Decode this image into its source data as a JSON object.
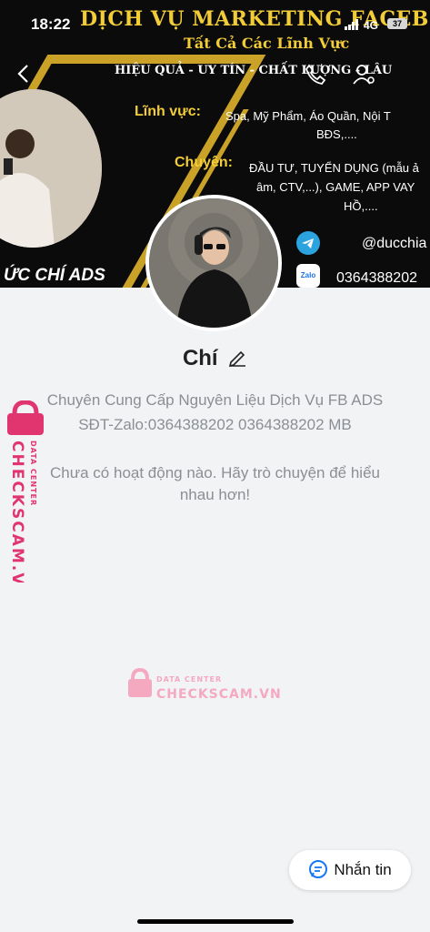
{
  "status": {
    "time": "18:22",
    "network": "4G",
    "battery": "37"
  },
  "cover": {
    "title": "DỊCH VỤ MARKETING FACEBOO",
    "subtitle": "Tất Cả Các Lĩnh Vực",
    "tagline": "HIỆU QUẢ - UY TÍN - CHẤT LƯỢNG - LÂU",
    "field_label": "Lĩnh vực:",
    "field_value": "Spa, Mỹ Phẩm, Áo Quần, Nội T",
    "field_value2": "BĐS,....",
    "spec_label": "Chuyên:",
    "spec_line1": "ĐẦU TƯ, TUYỂN DỤNG (mẫu ả",
    "spec_line2": "âm, CTV,...), GAME, APP VAY",
    "spec_line3": "HỒ,....",
    "telegram": "@ducchia",
    "zalo_label": "Zalo",
    "zalo": "0364388202",
    "brand": "ỨC CHÍ ADS"
  },
  "profile": {
    "name": "Chí",
    "bio_line1": "Chuyên Cung Cấp Nguyên Liệu Dịch Vụ FB ADS",
    "bio_line2": "SĐT-Zalo:0364388202  0364388202 MB",
    "empty_line1": "Chưa có hoạt động nào. Hãy trò chuyện để hiểu",
    "empty_line2": "nhau hơn!"
  },
  "watermark": {
    "small": "DATA CENTER",
    "big": "CHECKSCAM.VN"
  },
  "actions": {
    "message_label": "Nhắn tin"
  }
}
